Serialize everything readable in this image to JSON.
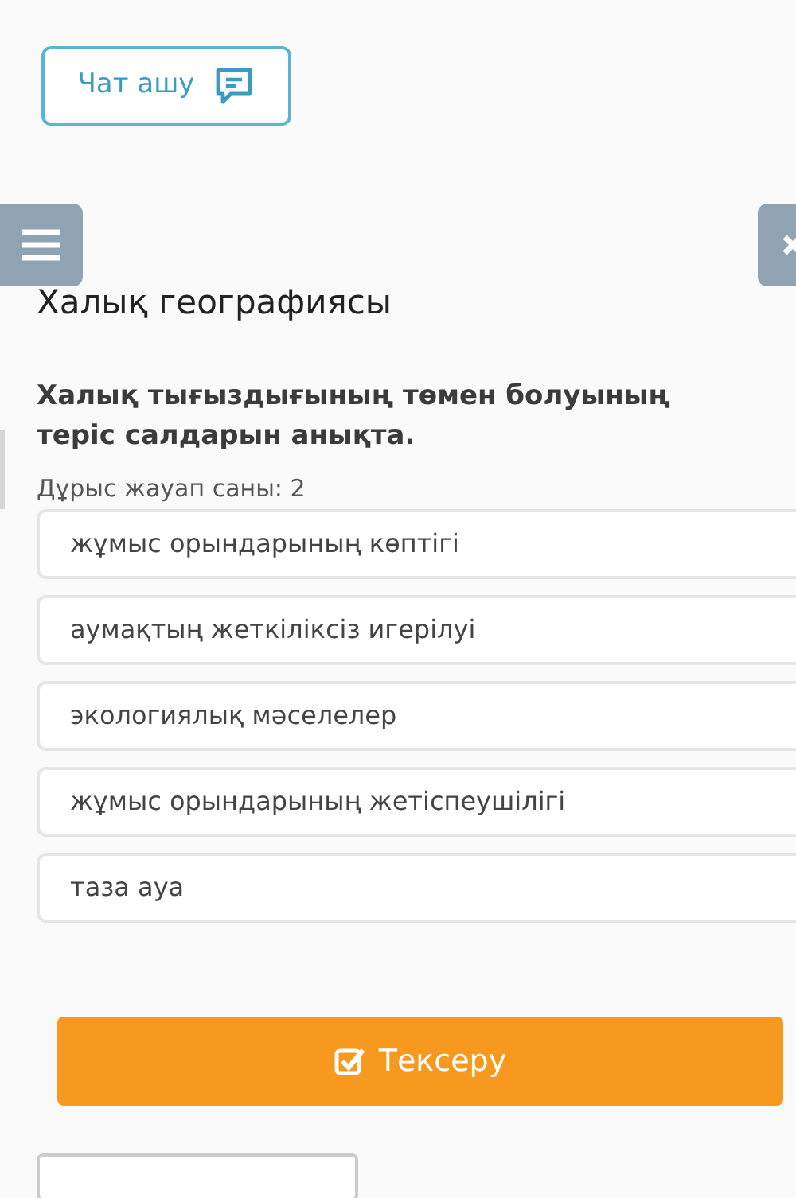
{
  "chat_button": {
    "label": "Чат ашу"
  },
  "title": "Халық географиясы",
  "question": "Халық тығыздығының төмен болуының теріс салдарын анықта.",
  "answer_count": "Дұрыс жауап саны: 2",
  "options": [
    {
      "label": "жұмыс орындарының көптігі"
    },
    {
      "label": "аумақтың жеткіліксіз игерілуі"
    },
    {
      "label": "экологиялық мәселелер"
    },
    {
      "label": "жұмыс орындарының жетіспеушілігі"
    },
    {
      "label": "таза ауа"
    }
  ],
  "check_button": {
    "label": "Тексеру"
  }
}
